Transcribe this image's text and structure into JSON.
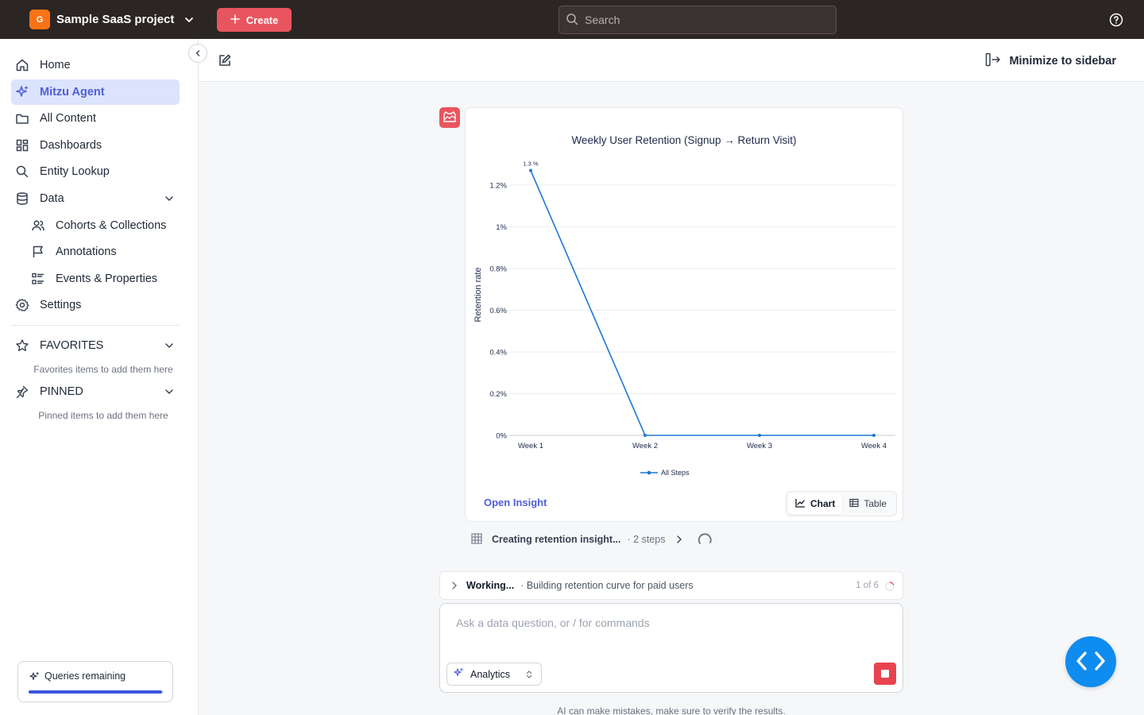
{
  "topbar": {
    "project_initial": "G",
    "project_name": "Sample SaaS project",
    "create_label": "Create",
    "search_placeholder": "Search"
  },
  "sidebar": {
    "items": [
      {
        "label": "Home",
        "icon": "home-icon"
      },
      {
        "label": "Mitzu Agent",
        "icon": "sparkle-icon",
        "active": true
      },
      {
        "label": "All Content",
        "icon": "folder-icon"
      },
      {
        "label": "Dashboards",
        "icon": "dashboard-icon"
      },
      {
        "label": "Entity Lookup",
        "icon": "search-icon"
      },
      {
        "label": "Data",
        "icon": "database-icon",
        "expanded": true
      },
      {
        "label": "Cohorts & Collections",
        "icon": "users-icon"
      },
      {
        "label": "Annotations",
        "icon": "flag-icon"
      },
      {
        "label": "Events & Properties",
        "icon": "list-icon"
      },
      {
        "label": "Settings",
        "icon": "gear-icon"
      }
    ],
    "favorites": {
      "label": "FAVORITES",
      "hint": "Favorites items to add them here"
    },
    "pinned": {
      "label": "PINNED",
      "hint": "Pinned items to add them here"
    },
    "queries": {
      "label": "Queries remaining",
      "fraction": 0.99
    }
  },
  "header": {
    "minimize_label": "Minimize to sidebar"
  },
  "insight": {
    "open_label": "Open Insight",
    "toggle": [
      {
        "label": "Chart",
        "selected": true
      },
      {
        "label": "Table",
        "selected": false
      }
    ]
  },
  "chart_data": {
    "type": "line",
    "title": "Weekly User Retention (Signup → Return Visit)",
    "xlabel": "",
    "ylabel": "Retention rate",
    "categories": [
      "Week 1",
      "Week 2",
      "Week 3",
      "Week 4"
    ],
    "series": [
      {
        "name": "All Steps",
        "values": [
          1.27,
          0,
          0,
          0
        ],
        "color": "#1f77d4"
      }
    ],
    "data_labels": [
      "1.3 %",
      "",
      "",
      ""
    ],
    "yticks": [
      "0%",
      "0.2%",
      "0.4%",
      "0.6%",
      "0.8%",
      "1%",
      "1.2%"
    ],
    "ylim": [
      0,
      1.2
    ],
    "legend": "bottom-center",
    "grid": true
  },
  "progress": {
    "title": "Creating retention insight...",
    "meta": "· 2 steps"
  },
  "working": {
    "title": "Working...",
    "desc": "· Building retention curve for paid users",
    "count": "1 of 6"
  },
  "composer": {
    "placeholder": "Ask a data question, or / for commands",
    "mode": "Analytics"
  },
  "disclaimer": "AI can make mistakes, make sure to verify the results.",
  "colors": {
    "accent": "#4f5fd6",
    "create": "#e8555f",
    "stop": "#e8444f",
    "fab": "#0f8cf0",
    "topbar": "#2b2523"
  }
}
